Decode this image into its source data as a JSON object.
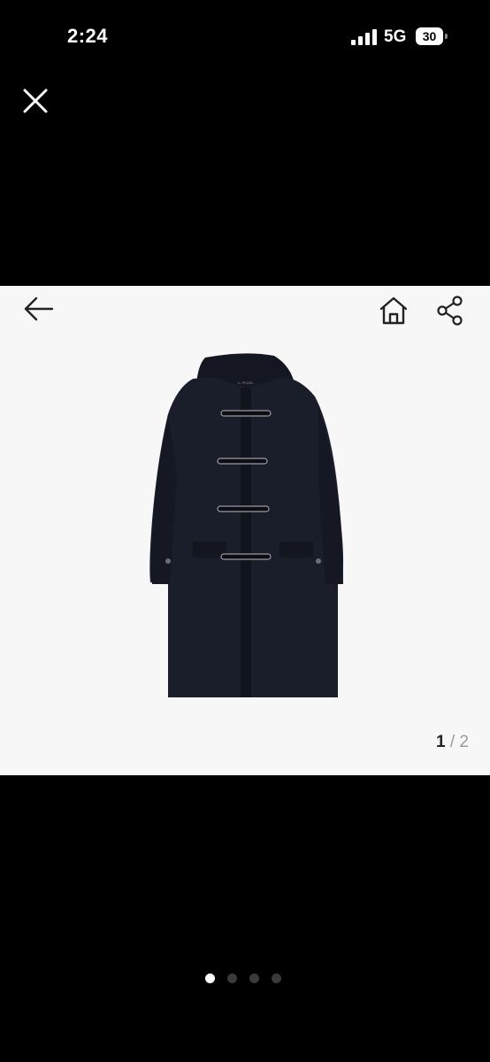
{
  "status_bar": {
    "time": "2:24",
    "network": "5G",
    "battery": "30"
  },
  "viewer": {
    "counter": {
      "current": "1",
      "separator": "/",
      "total": "2"
    },
    "brand_label": "IL PEARL"
  },
  "pager": {
    "count": 4,
    "active_index": 0
  },
  "icons": {
    "close": "close-icon",
    "back": "arrow-left-icon",
    "home": "home-icon",
    "share": "share-icon"
  },
  "colors": {
    "background": "#000000",
    "viewer_bg": "#f7f7f7",
    "coat": "#1a1d2a"
  }
}
